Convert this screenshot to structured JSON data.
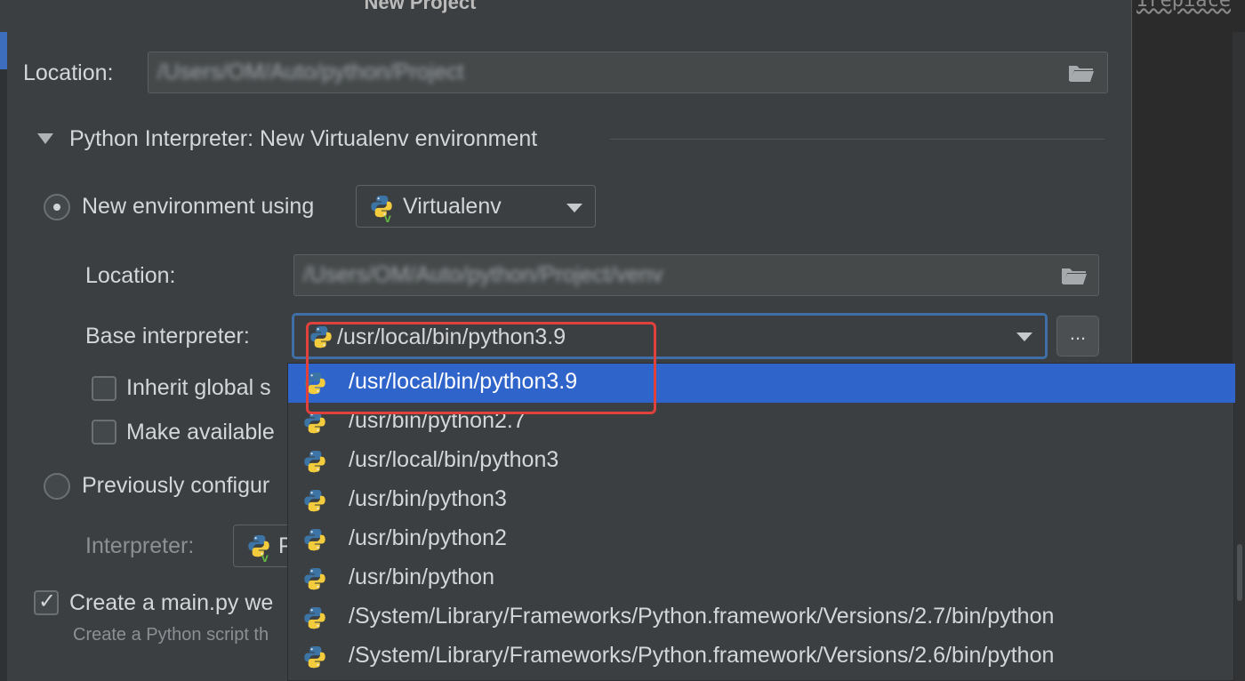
{
  "dialog": {
    "title": "New Project"
  },
  "location": {
    "label": "Location:",
    "value": "/Users/OM/Auto/python/Project"
  },
  "interpreter_section": {
    "title": "Python Interpreter: New Virtualenv environment",
    "new_env": {
      "label": "New environment using",
      "tool": "Virtualenv",
      "location_label": "Location:",
      "location_value": "/Users/OM/Auto/python/Project/venv",
      "base_label": "Base interpreter:",
      "base_value": "/usr/local/bin/python3.9",
      "ellipsis": "...",
      "inherit_label": "Inherit global s",
      "make_available_label": "Make available"
    },
    "previous": {
      "label": "Previously configur",
      "interpreter_label": "Interpreter:",
      "interpreter_value": "P"
    }
  },
  "create_main": {
    "label": "Create a main.py we",
    "hint": "Create a Python script th"
  },
  "dropdown": {
    "items": [
      "/usr/local/bin/python3.9",
      "/usr/bin/python2.7",
      "/usr/local/bin/python3",
      "/usr/bin/python3",
      "/usr/bin/python2",
      "/usr/bin/python",
      "/System/Library/Frameworks/Python.framework/Versions/2.7/bin/python",
      "/System/Library/Frameworks/Python.framework/Versions/2.6/bin/python"
    ],
    "selected_index": 0
  },
  "editor": {
    "text": "Irepiace"
  },
  "colors": {
    "selection": "#2f65ca",
    "focus_border": "#3f6fa6",
    "annotation": "#e0413c"
  }
}
